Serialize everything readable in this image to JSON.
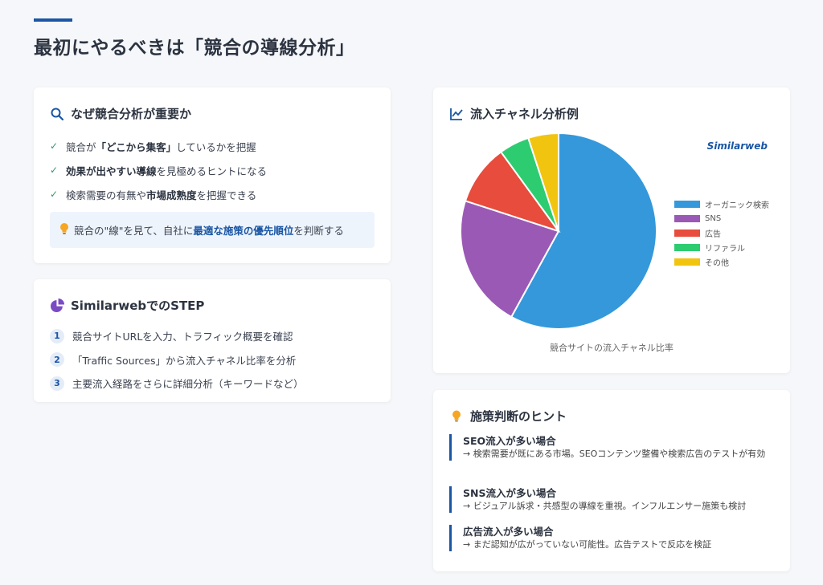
{
  "header": {
    "title": "最初にやるべきは「競合の導線分析」"
  },
  "why": {
    "title": "なぜ競合分析が重要か",
    "items": [
      {
        "pre": "競合が",
        "bold": "「どこから集客」",
        "post": "しているかを把握"
      },
      {
        "pre": "",
        "bold": "効果が出やすい導線",
        "post": "を見極めるヒントになる"
      },
      {
        "pre": "検索需要の有無や",
        "bold": "市場成熟度",
        "post": "を把握できる"
      }
    ],
    "tip": {
      "pre": "競合の\"線\"を見て、自社に",
      "hl": "最適な施策の優先順位",
      "post": "を判断する"
    }
  },
  "steps": {
    "title": "SimilarwebでのSTEP",
    "items": [
      {
        "num": "1",
        "text": "競合サイトURLを入力、トラフィック概要を確認"
      },
      {
        "num": "2",
        "text": "「Traffic Sources」から流入チャネル比率を分析"
      },
      {
        "num": "3",
        "text": "主要流入経路をさらに詳細分析（キーワードなど）"
      }
    ]
  },
  "chart_card": {
    "title": "流入チャネル分析例",
    "brand": "Similarweb",
    "caption": "競合サイトの流入チャネル比率"
  },
  "chart_data": {
    "type": "pie",
    "title": "",
    "categories": [
      "オーガニック検索",
      "SNS",
      "広告",
      "リファラル",
      "その他"
    ],
    "values": [
      58,
      22,
      10,
      5,
      5
    ],
    "colors": [
      "#3498db",
      "#9b59b6",
      "#e74c3c",
      "#2ecc71",
      "#f1c40f"
    ],
    "legend_position": "right"
  },
  "hints": {
    "title": "施策判断のヒント",
    "items": [
      {
        "title": "SEO流入が多い場合",
        "body": "→ 検索需要が既にある市場。SEOコンテンツ整備や検索広告のテストが有効"
      },
      {
        "title": "SNS流入が多い場合",
        "body": "→ ビジュアル訴求・共感型の導線を重視。インフルエンサー施策も検討"
      },
      {
        "title": "広告流入が多い場合",
        "body": "→ まだ認知が広がっていない可能性。広告テストで反応を検証"
      }
    ]
  }
}
